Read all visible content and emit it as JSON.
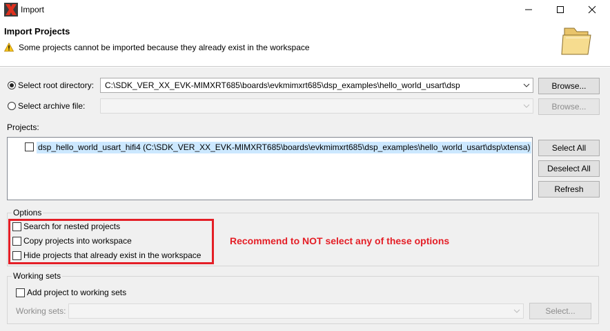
{
  "window": {
    "title": "Import"
  },
  "header": {
    "title": "Import Projects",
    "warning": "Some projects cannot be imported because they already exist in the workspace"
  },
  "source": {
    "root_label": "Select root directory:",
    "root_value": "C:\\SDK_VER_XX_EVK-MIMXRT685\\boards\\evkmimxrt685\\dsp_examples\\hello_world_usart\\dsp",
    "root_selected": true,
    "archive_label": "Select archive file:",
    "archive_value": "",
    "browse_label": "Browse...",
    "browse_archive_label": "Browse..."
  },
  "projects": {
    "label": "Projects:",
    "items": [
      {
        "text": "dsp_hello_world_usart_hifi4 (C:\\SDK_VER_XX_EVK-MIMXRT685\\boards\\evkmimxrt685\\dsp_examples\\hello_world_usart\\dsp\\xtensa)",
        "checked": false
      }
    ],
    "select_all": "Select All",
    "deselect_all": "Deselect All",
    "refresh": "Refresh"
  },
  "options": {
    "title": "Options",
    "items": [
      {
        "label": "Search for nested projects",
        "checked": false
      },
      {
        "label": "Copy projects into workspace",
        "checked": false
      },
      {
        "label": "Hide projects that already exist in the workspace",
        "checked": false
      }
    ],
    "annotation": "Recommend to NOT select any of these options"
  },
  "working_sets": {
    "title": "Working sets",
    "add_label": "Add project to working sets",
    "add_checked": false,
    "field_label": "Working sets:",
    "field_value": "",
    "select_button": "Select..."
  },
  "colors": {
    "annotation_red": "#e41e26",
    "selection_blue": "#cce8ff"
  }
}
